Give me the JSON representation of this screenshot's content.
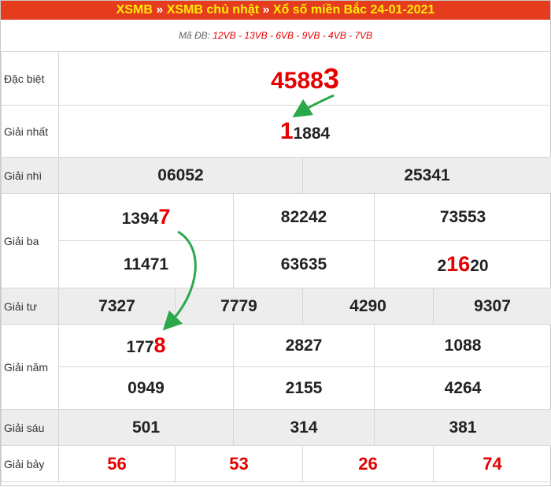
{
  "header": {
    "link1": "XSMB",
    "sep1": "»",
    "link2": "XSMB chủ nhật",
    "sep2": "»",
    "title": "Xổ số miền Bắc 24-01-2021"
  },
  "code": {
    "label": "Mã ĐB:",
    "values": "12VB - 13VB - 6VB - 9VB - 4VB - 7VB"
  },
  "rows": {
    "db": {
      "label": "Đặc biệt",
      "num_a": "4588",
      "num_b": "3"
    },
    "g1": {
      "label": "Giải nhất",
      "num_a": "1",
      "num_b": "1884"
    },
    "g2": {
      "label": "Giải nhì",
      "v1": "06052",
      "v2": "25341"
    },
    "g3": {
      "label": "Giải ba",
      "v1_a": "1394",
      "v1_b": "7",
      "v2": "82242",
      "v3": "73553",
      "v4": "11471",
      "v5": "63635",
      "v6_a": "2",
      "v6_b": "16",
      "v6_c": "20"
    },
    "g4": {
      "label": "Giải tư",
      "v1": "7327",
      "v2": "7779",
      "v3": "4290",
      "v4": "9307"
    },
    "g5": {
      "label": "Giải năm",
      "v1_a": "177",
      "v1_b": "8",
      "v2": "2827",
      "v3": "1088",
      "v4": "0949",
      "v5": "2155",
      "v6": "4264"
    },
    "g6": {
      "label": "Giải sáu",
      "v1": "501",
      "v2": "314",
      "v3": "381"
    },
    "g7": {
      "label": "Giải bảy",
      "v1": "56",
      "v2": "53",
      "v3": "26",
      "v4": "74"
    }
  },
  "colors": {
    "header_bg": "#e63c1e",
    "header_text": "#ffec00",
    "highlight": "#e60000",
    "arrow": "#2aa84a",
    "row_grey": "#ededed"
  }
}
